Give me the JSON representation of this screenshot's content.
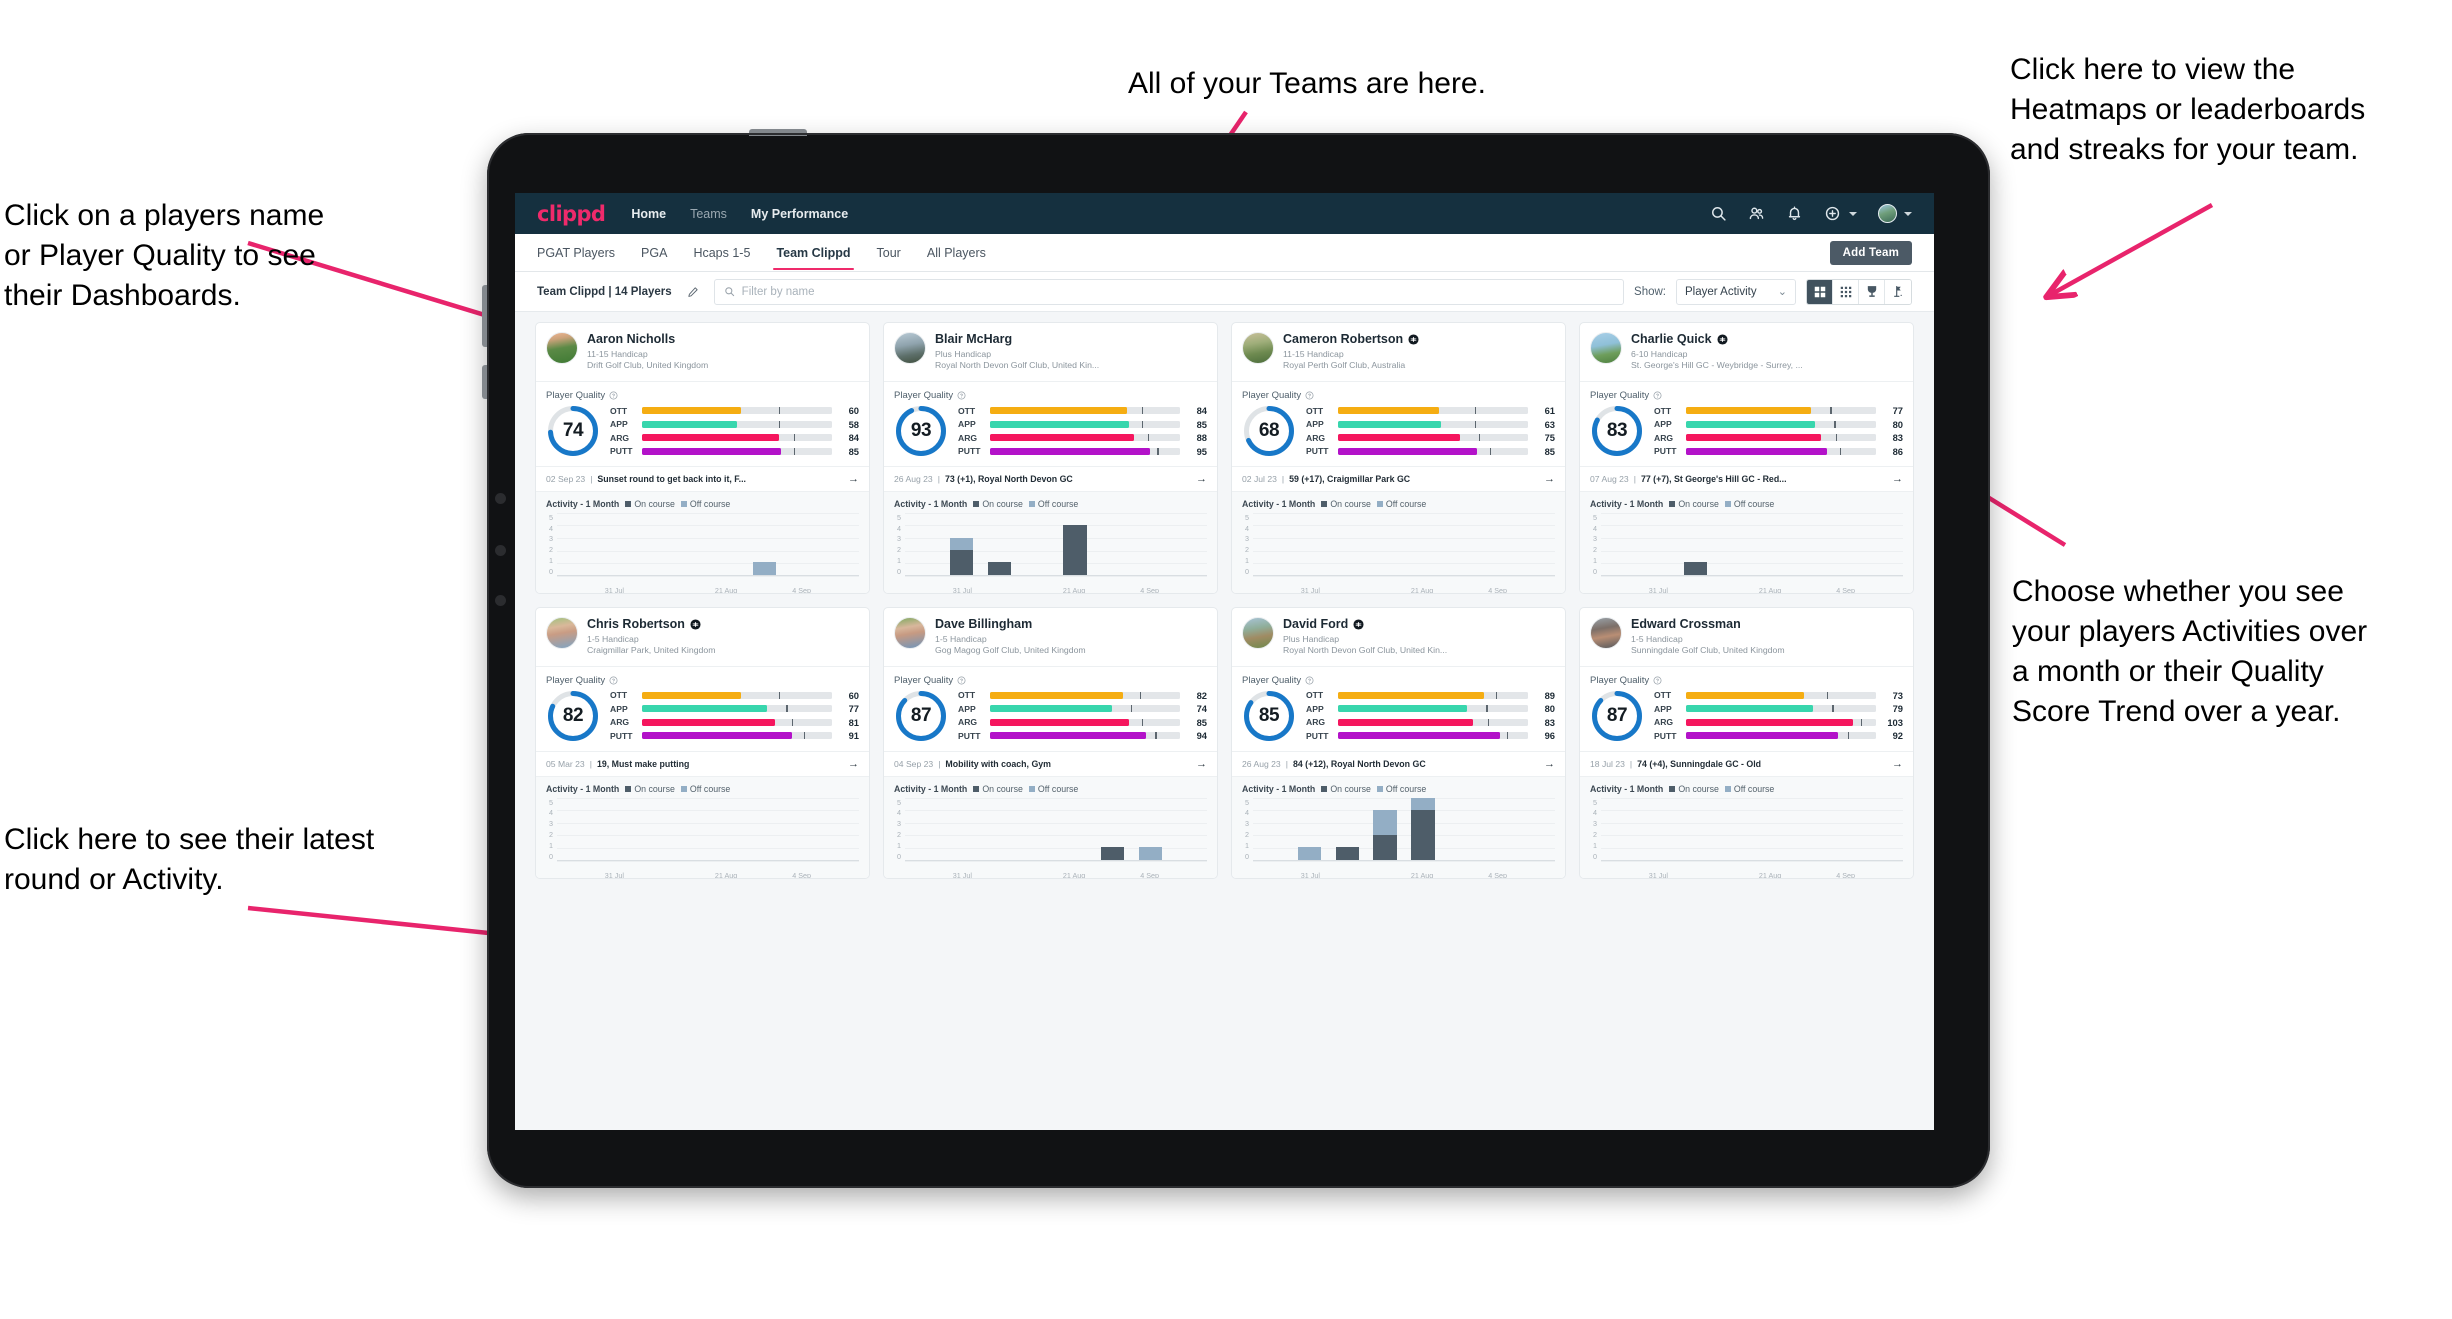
{
  "annotations": {
    "top": "All of your Teams are here.",
    "top_right": "Click here to view the\nHeatmaps or leaderboards\nand streaks for your team.",
    "left_top": "Click on a players name\nor Player Quality to see\ntheir Dashboards.",
    "left_bottom": "Click here to see their latest\nround or Activity.",
    "right_bottom": "Choose whether you see\nyour players Activities over\na month or their Quality\nScore Trend over a year.",
    "arrow_color": "#e8246c"
  },
  "app": {
    "brand": "clippd",
    "nav": [
      {
        "label": "Home",
        "active": true
      },
      {
        "label": "Teams",
        "active": false
      },
      {
        "label": "My Performance",
        "active": false
      }
    ],
    "nav_icons": [
      "search-icon",
      "people-icon",
      "bell-icon",
      "plus-circle-icon",
      "avatar"
    ],
    "tabs": [
      {
        "label": "PGAT Players",
        "active": false
      },
      {
        "label": "PGA",
        "active": false
      },
      {
        "label": "Hcaps 1-5",
        "active": false
      },
      {
        "label": "Team Clippd",
        "active": true
      },
      {
        "label": "Tour",
        "active": false
      },
      {
        "label": "All Players",
        "active": false
      }
    ],
    "add_team_label": "Add Team",
    "filter": {
      "team_label": "Team Clippd | 14 Players",
      "edit_icon": "pencil-icon",
      "search_placeholder": "Filter by name",
      "show_label": "Show:",
      "show_value": "Player Activity",
      "view_modes": [
        {
          "icon": "grid-large-icon",
          "active": true
        },
        {
          "icon": "grid-dense-icon",
          "active": false
        },
        {
          "icon": "trophy-icon",
          "active": false
        },
        {
          "icon": "flag-stat-icon",
          "active": false
        }
      ]
    },
    "card_labels": {
      "quality_title": "Player Quality",
      "help_icon": "help-circle-icon",
      "activity_title": "Activity - 1 Month",
      "legend_on": "On course",
      "legend_off": "Off course",
      "arrow_icon": "arrow-right-icon"
    },
    "colors": {
      "brand_pink": "#ef2a6b",
      "navy": "#15303f",
      "ring_blue": "#1878c8",
      "ott": "#f5ad12",
      "app": "#38d6ad",
      "arg": "#f5165e",
      "putt": "#b312c9",
      "on_course": "#4e5d69",
      "off_course": "#93aec5"
    },
    "chart_axis": {
      "y_ticks": [
        "5",
        "4",
        "3",
        "2",
        "1",
        "0"
      ],
      "y_max": 5,
      "x_ticks": [
        "31 Jul",
        "21 Aug",
        "4 Sep"
      ],
      "slots": 8
    }
  },
  "players": [
    {
      "name": "Aaron Nicholls",
      "verified": false,
      "handicap": "11-15 Handicap",
      "club": "Drift Golf Club, United Kingdom",
      "avatar_css": "linear-gradient(170deg,#f0b694 0%,#caa27a 22%,#5b8a46 50%,#3f7a34 100%)",
      "quality": 74,
      "metrics": [
        {
          "key": "OTT",
          "value": 60,
          "fill": 52,
          "mark": 72
        },
        {
          "key": "APP",
          "value": 58,
          "fill": 50,
          "mark": 72
        },
        {
          "key": "ARG",
          "value": 84,
          "fill": 72,
          "mark": 80
        },
        {
          "key": "PUTT",
          "value": 85,
          "fill": 73,
          "mark": 80
        }
      ],
      "round_date": "02 Sep 23",
      "round_text": "Sunset round to get back into it, F...",
      "activity": [
        {
          "on": 0,
          "off": 0
        },
        {
          "on": 0,
          "off": 0
        },
        {
          "on": 0,
          "off": 0
        },
        {
          "on": 0,
          "off": 0
        },
        {
          "on": 0,
          "off": 0
        },
        {
          "on": 0,
          "off": 1
        },
        {
          "on": 0,
          "off": 0
        },
        {
          "on": 0,
          "off": 0
        }
      ]
    },
    {
      "name": "Blair McHarg",
      "verified": false,
      "handicap": "Plus Handicap",
      "club": "Royal North Devon Golf Club, United Kin...",
      "avatar_css": "linear-gradient(170deg,#b9cbd6 0%,#8fa3ad 40%,#5d6f6a 70%,#41503f 100%)",
      "quality": 93,
      "metrics": [
        {
          "key": "OTT",
          "value": 84,
          "fill": 72,
          "mark": 80
        },
        {
          "key": "APP",
          "value": 85,
          "fill": 73,
          "mark": 80
        },
        {
          "key": "ARG",
          "value": 88,
          "fill": 76,
          "mark": 83
        },
        {
          "key": "PUTT",
          "value": 95,
          "fill": 84,
          "mark": 88
        }
      ],
      "round_date": "26 Aug 23",
      "round_text": "73 (+1), Royal North Devon GC",
      "activity": [
        {
          "on": 0,
          "off": 0
        },
        {
          "on": 2,
          "off": 1
        },
        {
          "on": 1,
          "off": 0
        },
        {
          "on": 0,
          "off": 0
        },
        {
          "on": 4,
          "off": 0
        },
        {
          "on": 0,
          "off": 0
        },
        {
          "on": 0,
          "off": 0
        },
        {
          "on": 0,
          "off": 0
        }
      ]
    },
    {
      "name": "Cameron Robertson",
      "verified": true,
      "handicap": "11-15 Handicap",
      "club": "Royal Perth Golf Club, Australia",
      "avatar_css": "linear-gradient(170deg,#c9c09a 0%,#9fae7a 35%,#6e8a50 65%,#4d6e3c 100%)",
      "quality": 68,
      "metrics": [
        {
          "key": "OTT",
          "value": 61,
          "fill": 53,
          "mark": 72
        },
        {
          "key": "APP",
          "value": 63,
          "fill": 54,
          "mark": 72
        },
        {
          "key": "ARG",
          "value": 75,
          "fill": 64,
          "mark": 74
        },
        {
          "key": "PUTT",
          "value": 85,
          "fill": 73,
          "mark": 80
        }
      ],
      "round_date": "02 Jul 23",
      "round_text": "59 (+17), Craigmillar Park GC",
      "activity": [
        {
          "on": 0,
          "off": 0
        },
        {
          "on": 0,
          "off": 0
        },
        {
          "on": 0,
          "off": 0
        },
        {
          "on": 0,
          "off": 0
        },
        {
          "on": 0,
          "off": 0
        },
        {
          "on": 0,
          "off": 0
        },
        {
          "on": 0,
          "off": 0
        },
        {
          "on": 0,
          "off": 0
        }
      ]
    },
    {
      "name": "Charlie Quick",
      "verified": true,
      "handicap": "6-10 Handicap",
      "club": "St. George's Hill GC - Weybridge - Surrey, ...",
      "avatar_css": "linear-gradient(170deg,#a8cfe8 0%,#8fc0d8 40%,#6e9e5c 68%,#4f8140 100%)",
      "quality": 83,
      "metrics": [
        {
          "key": "OTT",
          "value": 77,
          "fill": 66,
          "mark": 76
        },
        {
          "key": "APP",
          "value": 80,
          "fill": 68,
          "mark": 78
        },
        {
          "key": "ARG",
          "value": 83,
          "fill": 71,
          "mark": 79
        },
        {
          "key": "PUTT",
          "value": 86,
          "fill": 74,
          "mark": 81
        }
      ],
      "round_date": "07 Aug 23",
      "round_text": "77 (+7), St George's Hill GC - Red...",
      "activity": [
        {
          "on": 0,
          "off": 0
        },
        {
          "on": 0,
          "off": 0
        },
        {
          "on": 1,
          "off": 0
        },
        {
          "on": 0,
          "off": 0
        },
        {
          "on": 0,
          "off": 0
        },
        {
          "on": 0,
          "off": 0
        },
        {
          "on": 0,
          "off": 0
        },
        {
          "on": 0,
          "off": 0
        }
      ]
    },
    {
      "name": "Chris Robertson",
      "verified": true,
      "handicap": "1-5 Handicap",
      "club": "Craigmillar Park, United Kingdom",
      "avatar_css": "linear-gradient(170deg,#9fc27e 0%,#d9b89a 30%,#c99c84 50%,#7fa4c4 100%)",
      "quality": 82,
      "metrics": [
        {
          "key": "OTT",
          "value": 60,
          "fill": 52,
          "mark": 72
        },
        {
          "key": "APP",
          "value": 77,
          "fill": 66,
          "mark": 76
        },
        {
          "key": "ARG",
          "value": 81,
          "fill": 70,
          "mark": 79
        },
        {
          "key": "PUTT",
          "value": 91,
          "fill": 79,
          "mark": 85
        }
      ],
      "round_date": "05 Mar 23",
      "round_text": "19, Must make putting",
      "activity": [
        {
          "on": 0,
          "off": 0
        },
        {
          "on": 0,
          "off": 0
        },
        {
          "on": 0,
          "off": 0
        },
        {
          "on": 0,
          "off": 0
        },
        {
          "on": 0,
          "off": 0
        },
        {
          "on": 0,
          "off": 0
        },
        {
          "on": 0,
          "off": 0
        },
        {
          "on": 0,
          "off": 0
        }
      ]
    },
    {
      "name": "Dave Billingham",
      "verified": false,
      "handicap": "1-5 Handicap",
      "club": "Gog Magog Golf Club, United Kingdom",
      "avatar_css": "linear-gradient(170deg,#7ea95f 0%,#d8b79c 32%,#c79a82 52%,#6f95bb 100%)",
      "quality": 87,
      "metrics": [
        {
          "key": "OTT",
          "value": 82,
          "fill": 70,
          "mark": 79
        },
        {
          "key": "APP",
          "value": 74,
          "fill": 64,
          "mark": 74
        },
        {
          "key": "ARG",
          "value": 85,
          "fill": 73,
          "mark": 80
        },
        {
          "key": "PUTT",
          "value": 94,
          "fill": 82,
          "mark": 87
        }
      ],
      "round_date": "04 Sep 23",
      "round_text": "Mobility with coach, Gym",
      "activity": [
        {
          "on": 0,
          "off": 0
        },
        {
          "on": 0,
          "off": 0
        },
        {
          "on": 0,
          "off": 0
        },
        {
          "on": 0,
          "off": 0
        },
        {
          "on": 0,
          "off": 0
        },
        {
          "on": 1,
          "off": 0
        },
        {
          "on": 0,
          "off": 1
        },
        {
          "on": 0,
          "off": 0
        }
      ]
    },
    {
      "name": "David Ford",
      "verified": true,
      "handicap": "Plus Handicap",
      "club": "Royal North Devon Golf Club, United Kin...",
      "avatar_css": "linear-gradient(170deg,#a9c4d8 0%,#8fae9a 35%,#a08b63 62%,#6e8a4c 100%)",
      "quality": 85,
      "metrics": [
        {
          "key": "OTT",
          "value": 89,
          "fill": 77,
          "mark": 83
        },
        {
          "key": "APP",
          "value": 80,
          "fill": 68,
          "mark": 78
        },
        {
          "key": "ARG",
          "value": 83,
          "fill": 71,
          "mark": 79
        },
        {
          "key": "PUTT",
          "value": 96,
          "fill": 85,
          "mark": 89
        }
      ],
      "round_date": "26 Aug 23",
      "round_text": "84 (+12), Royal North Devon GC",
      "activity": [
        {
          "on": 0,
          "off": 0
        },
        {
          "on": 0,
          "off": 1
        },
        {
          "on": 1,
          "off": 0
        },
        {
          "on": 2,
          "off": 2
        },
        {
          "on": 4,
          "off": 1
        },
        {
          "on": 0,
          "off": 0
        },
        {
          "on": 0,
          "off": 0
        },
        {
          "on": 0,
          "off": 0
        }
      ]
    },
    {
      "name": "Edward Crossman",
      "verified": false,
      "handicap": "1-5 Handicap",
      "club": "Sunningdale Golf Club, United Kingdom",
      "avatar_css": "linear-gradient(170deg,#9aa3aa 0%,#7c6f68 35%,#b98e74 60%,#55585c 100%)",
      "quality": 87,
      "metrics": [
        {
          "key": "OTT",
          "value": 73,
          "fill": 62,
          "mark": 74
        },
        {
          "key": "APP",
          "value": 79,
          "fill": 67,
          "mark": 77
        },
        {
          "key": "ARG",
          "value": 103,
          "fill": 88,
          "mark": 92
        },
        {
          "key": "PUTT",
          "value": 92,
          "fill": 80,
          "mark": 85
        }
      ],
      "round_date": "18 Jul 23",
      "round_text": "74 (+4), Sunningdale GC - Old",
      "activity": [
        {
          "on": 0,
          "off": 0
        },
        {
          "on": 0,
          "off": 0
        },
        {
          "on": 0,
          "off": 0
        },
        {
          "on": 0,
          "off": 0
        },
        {
          "on": 0,
          "off": 0
        },
        {
          "on": 0,
          "off": 0
        },
        {
          "on": 0,
          "off": 0
        },
        {
          "on": 0,
          "off": 0
        }
      ]
    }
  ]
}
